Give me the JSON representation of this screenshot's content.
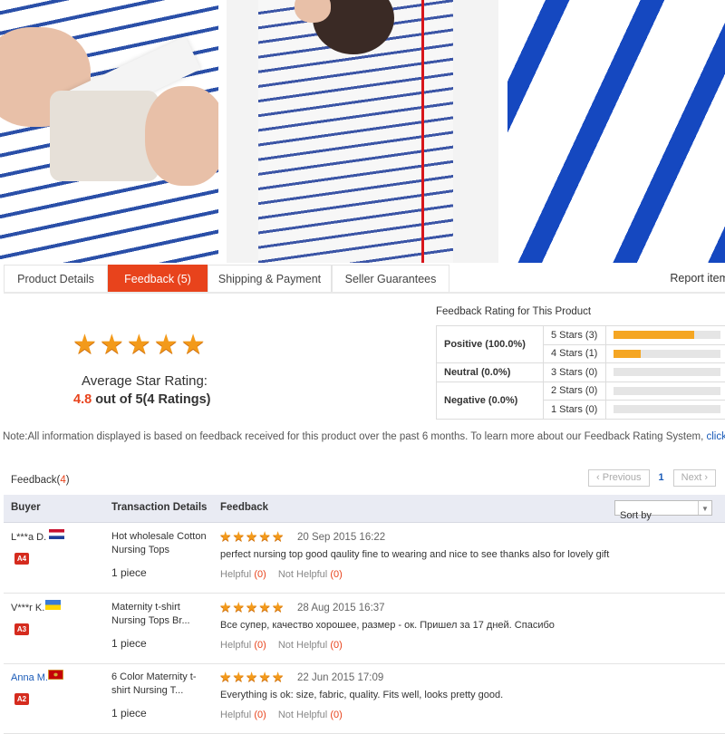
{
  "tabs": [
    {
      "label": "Product Details"
    },
    {
      "label": "Feedback (5)"
    },
    {
      "label": "Shipping & Payment"
    },
    {
      "label": "Seller Guarantees"
    }
  ],
  "report_label": "Report item",
  "summary": {
    "avg_label": "Average Star Rating:",
    "avg_value": "4.8",
    "avg_suffix": " out of 5(4 Ratings)"
  },
  "rating_table": {
    "title": "Feedback Rating for This Product",
    "positive": "Positive (100.0%)",
    "neutral": "Neutral (0.0%)",
    "negative": "Negative (0.0%)",
    "rows": [
      {
        "label": "5 Stars (3)",
        "fraction": 0.75
      },
      {
        "label": "4 Stars (1)",
        "fraction": 0.25
      },
      {
        "label": "3 Stars (0)",
        "fraction": 0
      },
      {
        "label": "2 Stars (0)",
        "fraction": 0
      },
      {
        "label": "1 Stars (0)",
        "fraction": 0
      }
    ]
  },
  "note": {
    "text": "Note:All information displayed is based on feedback received for this product over the past 6 months. To learn more about our Feedback Rating System, ",
    "link": "click here"
  },
  "feedback_list": {
    "title": "Feedback(",
    "count": "4",
    "title_end": ")",
    "pager": {
      "prev": "Previous",
      "current": "1",
      "next": "Next"
    },
    "headers": {
      "buyer": "Buyer",
      "transaction": "Transaction Details",
      "feedback": "Feedback",
      "sort": "Sort by"
    }
  },
  "reviews": [
    {
      "buyer": "L***a D.",
      "level": "A4",
      "flag": "nl",
      "product": "Hot wholesale Cotton Nursing Tops",
      "qty": "1 piece",
      "rating": 5,
      "date": "20 Sep 2015 16:22",
      "text": "perfect nursing top good qaulity fine to wearing and nice to see thanks also for lovely gift",
      "helpful_label": "Helpful",
      "helpful": "(0)",
      "not_helpful_label": "Not Helpful",
      "not_helpful": "(0)"
    },
    {
      "buyer": "V***r K.",
      "level": "A3",
      "flag": "ua",
      "product": "Maternity t-shirt Nursing Tops Br...",
      "qty": "1 piece",
      "rating": 5,
      "date": "28 Aug 2015 16:37",
      "text": "Все супер, качество хорошее, размер - ок. Пришел за 17 дней. Спасибо",
      "helpful_label": "Helpful",
      "helpful": "(0)",
      "not_helpful_label": "Not Helpful",
      "not_helpful": "(0)"
    },
    {
      "buyer": "Anna M.",
      "level": "A2",
      "flag": "me",
      "product": "6 Color Maternity t-shirt Nursing T...",
      "qty": "1 piece",
      "rating": 5,
      "date": "22 Jun 2015 17:09",
      "text": "Everything is ok: size, fabric, quality. Fits well, looks pretty good.",
      "helpful_label": "Helpful",
      "helpful": "(0)",
      "not_helpful_label": "Not Helpful",
      "not_helpful": "(0)"
    }
  ],
  "colors": {
    "accent": "#e8431c",
    "star": "#f39a1a",
    "link": "#1a5bb8",
    "bar": "#f5a623"
  }
}
